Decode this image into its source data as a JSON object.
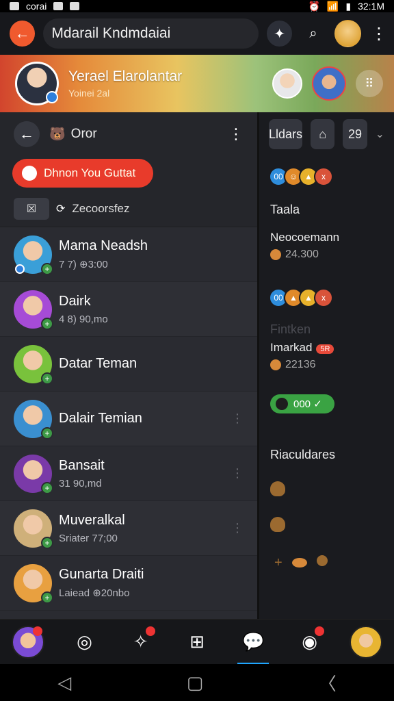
{
  "status_bar": {
    "carrier": "corai",
    "time": "32:1M"
  },
  "app_bar": {
    "title": "Mdarail Kndmdaiai",
    "back_icon": "arrow-left-icon",
    "icons": [
      "compass-icon",
      "search-icon",
      "avatar",
      "more-vertical-icon"
    ]
  },
  "banner": {
    "name": "Yerael Elarolantar",
    "subtitle": "Yoinei 2al",
    "grid_glyph": "⠿"
  },
  "left_panel": {
    "header_title": "Oror",
    "back_glyph": "←",
    "more_glyph": "⋮",
    "primary_pill": "Dhnon You Guttat",
    "search_label": "Zecoorsfez",
    "search_glyph": "☒",
    "contacts": [
      {
        "name": "Mama Neadsh",
        "sub": "7 7) ⊕3:00",
        "color": "#3a9fd8"
      },
      {
        "name": "Dairk",
        "sub": "4 8) 90,mo",
        "color": "#a64bd6"
      },
      {
        "name": "Datar Teman",
        "sub": "",
        "color": "#79c23c"
      },
      {
        "name": "Dalair Temian",
        "sub": "",
        "color": "#3a8fd0"
      },
      {
        "name": "Bansait",
        "sub": "31 90,md",
        "color": "#7a3aa8"
      },
      {
        "name": "Muveralkal",
        "sub": "Sriater 77;00",
        "color": "#cfb07a"
      },
      {
        "name": "Gunarta Draiti",
        "sub": "Laiead ⊕20nbo",
        "color": "#e8a040"
      }
    ]
  },
  "right_panel": {
    "tabs": [
      "Lldars",
      "⌂",
      "29"
    ],
    "chip_rows": [
      [
        "00",
        "☺",
        "▲",
        "x"
      ],
      [
        "00",
        "▲",
        "▲",
        "x"
      ]
    ],
    "section_1": "Taala",
    "item_1_name": "Neocoemann",
    "item_1_sub": "24.300",
    "section_2": "Fintken",
    "item_2_name": "Imarkad",
    "item_2_badge": "5R",
    "item_2_sub": "22136",
    "green_pill": "000 ✓",
    "section_3": "Riaculdares"
  },
  "bottom_nav": {
    "items": [
      "avatar",
      "circle-icon",
      "star-icon",
      "grid-icon",
      "chat-icon",
      "user-icon",
      "avatar"
    ]
  },
  "system_nav": {
    "items": [
      "◁",
      "▢",
      "〈"
    ]
  }
}
